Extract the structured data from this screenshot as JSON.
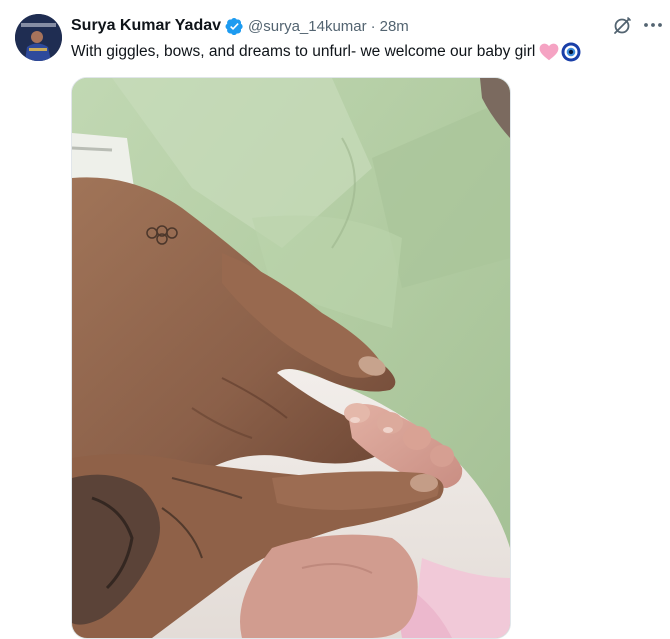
{
  "tweet": {
    "author_name": "Surya Kumar Yadav",
    "handle": "@surya_14kumar",
    "separator": "·",
    "time": "28m",
    "text": "With giggles, bows, and dreams to unfurl- we welcome our baby girl",
    "emojis": [
      "pink-heart-icon",
      "nazar-amulet-icon"
    ]
  },
  "colors": {
    "verified": "#1d9bf0",
    "secondary_text": "#536471",
    "primary_text": "#0f1419",
    "heart": "#f7a1c4"
  },
  "icons": {
    "grok": "grok-icon",
    "more": "more-options-icon",
    "verified": "verified-badge-icon"
  }
}
